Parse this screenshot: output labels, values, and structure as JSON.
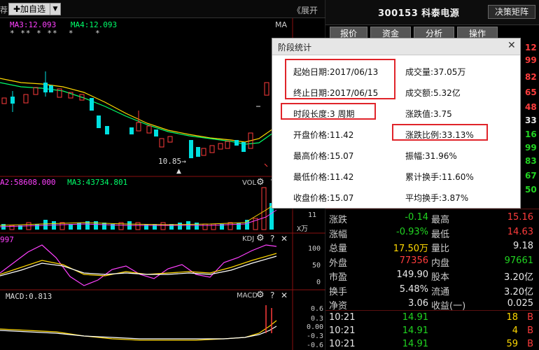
{
  "toolbar": {
    "left_glyph": "荐",
    "add_button": "✚加自选",
    "add_arrow": "▼",
    "expand": "《展开"
  },
  "header": {
    "stock_title": "300153  科泰电源",
    "decision_button": "决策矩阵",
    "tabs": [
      "报价",
      "资金",
      "分析",
      "操作"
    ]
  },
  "main_chart": {
    "ma3_legend": "MA3:12.093",
    "ma4_legend": "MA4:12.093",
    "stars": "* ** * **  *    *",
    "ma_label": "MA",
    "low_label": "10.85→",
    "up_marker": "▲"
  },
  "volume_pane": {
    "ma2_legend": "A2:58608.000",
    "ma3_legend": "MA3:43734.801",
    "label": "VOL",
    "axis_value": "11",
    "axis_unit": "X万"
  },
  "kdj_pane": {
    "left_value": "997",
    "label": "KDJ",
    "ticks": [
      "100",
      "50",
      "0"
    ]
  },
  "macd_pane": {
    "legend": "MACD:0.813",
    "label": "MACD",
    "ticks": [
      "0.6",
      "0.3",
      "0.00",
      "-0.3",
      "-0.6"
    ]
  },
  "pane_tools": {
    "gear": "⚙",
    "question": "?",
    "close": "✕"
  },
  "right_edge_numbers": [
    {
      "text": "12",
      "color": "#ff3c3c"
    },
    {
      "text": "99",
      "color": "#ff3c3c"
    },
    {
      "text": "82",
      "color": "#ff3c3c"
    },
    {
      "text": "65",
      "color": "#ff3c3c"
    },
    {
      "text": "48",
      "color": "#ff3c3c"
    },
    {
      "text": "33",
      "color": "#e8e8e8"
    },
    {
      "text": "16",
      "color": "#21d421"
    },
    {
      "text": "99",
      "color": "#21d421"
    },
    {
      "text": "83",
      "color": "#21d421"
    },
    {
      "text": "67",
      "color": "#21d421"
    },
    {
      "text": "50",
      "color": "#21d421"
    }
  ],
  "quote": {
    "rows": [
      {
        "l1": "涨跌",
        "v1": "-0.14",
        "c1": "green",
        "l2": "最高",
        "v2": "15.16",
        "c2": "red"
      },
      {
        "l1": "涨幅",
        "v1": "-0.93%",
        "c1": "green",
        "l2": "最低",
        "v2": "14.63",
        "c2": "red"
      },
      {
        "l1": "总量",
        "v1": "17.50万",
        "c1": "yellow",
        "l2": "量比",
        "v2": "9.18",
        "c2": "white"
      },
      {
        "l1": "外盘",
        "v1": "77356",
        "c1": "red",
        "l2": "内盘",
        "v2": "97661",
        "c2": "green"
      },
      {
        "l1": "市盈",
        "v1": "149.90",
        "c1": "white",
        "l2": "股本",
        "v2": "3.20亿",
        "c2": "white"
      },
      {
        "l1": "换手",
        "v1": "5.48%",
        "c1": "white",
        "l2": "流通",
        "v2": "3.20亿",
        "c2": "white"
      },
      {
        "l1": "净资",
        "v1": "3.06",
        "c1": "white",
        "l2": "收益(一)",
        "v2": "0.025",
        "c2": "white"
      }
    ],
    "ticks": [
      {
        "time": "10:21",
        "price": "14.91",
        "vol": "18",
        "side": "B"
      },
      {
        "time": "10:21",
        "price": "14.91",
        "vol": "4",
        "side": "B"
      },
      {
        "time": "10:21",
        "price": "14.91",
        "vol": "59",
        "side": "B"
      }
    ]
  },
  "dialog": {
    "title": "阶段统计",
    "close": "✕",
    "start_date": "起始日期:2017/06/13",
    "end_date": "终止日期:2017/06/15",
    "period": "时段长度:3 周期",
    "volume": "成交量:37.05万",
    "amount": "成交额:5.32亿",
    "change_value": "涨跌值:3.75",
    "open_price": "开盘价格:11.42",
    "change_pct": "涨跌比例:33.13%",
    "high_price": "最高价格:15.07",
    "amplitude": "振幅:31.96%",
    "low_price": "最低价格:11.42",
    "cum_turnover": "累计换手:11.60%",
    "close_price": "收盘价格:15.07",
    "avg_turnover": "平均换手:3.87%"
  },
  "colors": {
    "up": "#ff3c3c",
    "down": "#21d421",
    "cyan": "#00e0e0",
    "ma_yellow": "#ffd800",
    "ma_green": "#00ff6a",
    "magenta": "#ff40ff",
    "highlight_box": "#e0242a"
  }
}
